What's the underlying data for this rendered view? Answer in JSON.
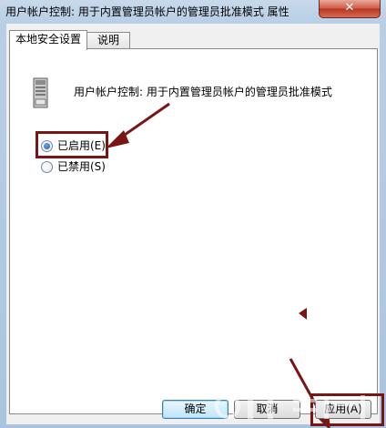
{
  "window": {
    "title": "用户帐户控制: 用于内置管理员帐户的管理员批准模式 属性",
    "close_icon": "close-icon"
  },
  "tabs": [
    {
      "label": "本地安全设置",
      "active": true
    },
    {
      "label": "说明",
      "active": false
    }
  ],
  "panel": {
    "policy_icon": "server-icon",
    "policy_name": "用户帐户控制: 用于内置管理员帐户的管理员批准模式",
    "options": [
      {
        "label": "已启用(E)",
        "selected": true
      },
      {
        "label": "已禁用(S)",
        "selected": false
      }
    ]
  },
  "buttons": {
    "ok": "确定",
    "cancel": "取消",
    "apply": "应用(A)"
  },
  "colors": {
    "annotation": "#7a1515",
    "title_bar": "#b9cfe6",
    "close_button": "#cf5a43"
  }
}
